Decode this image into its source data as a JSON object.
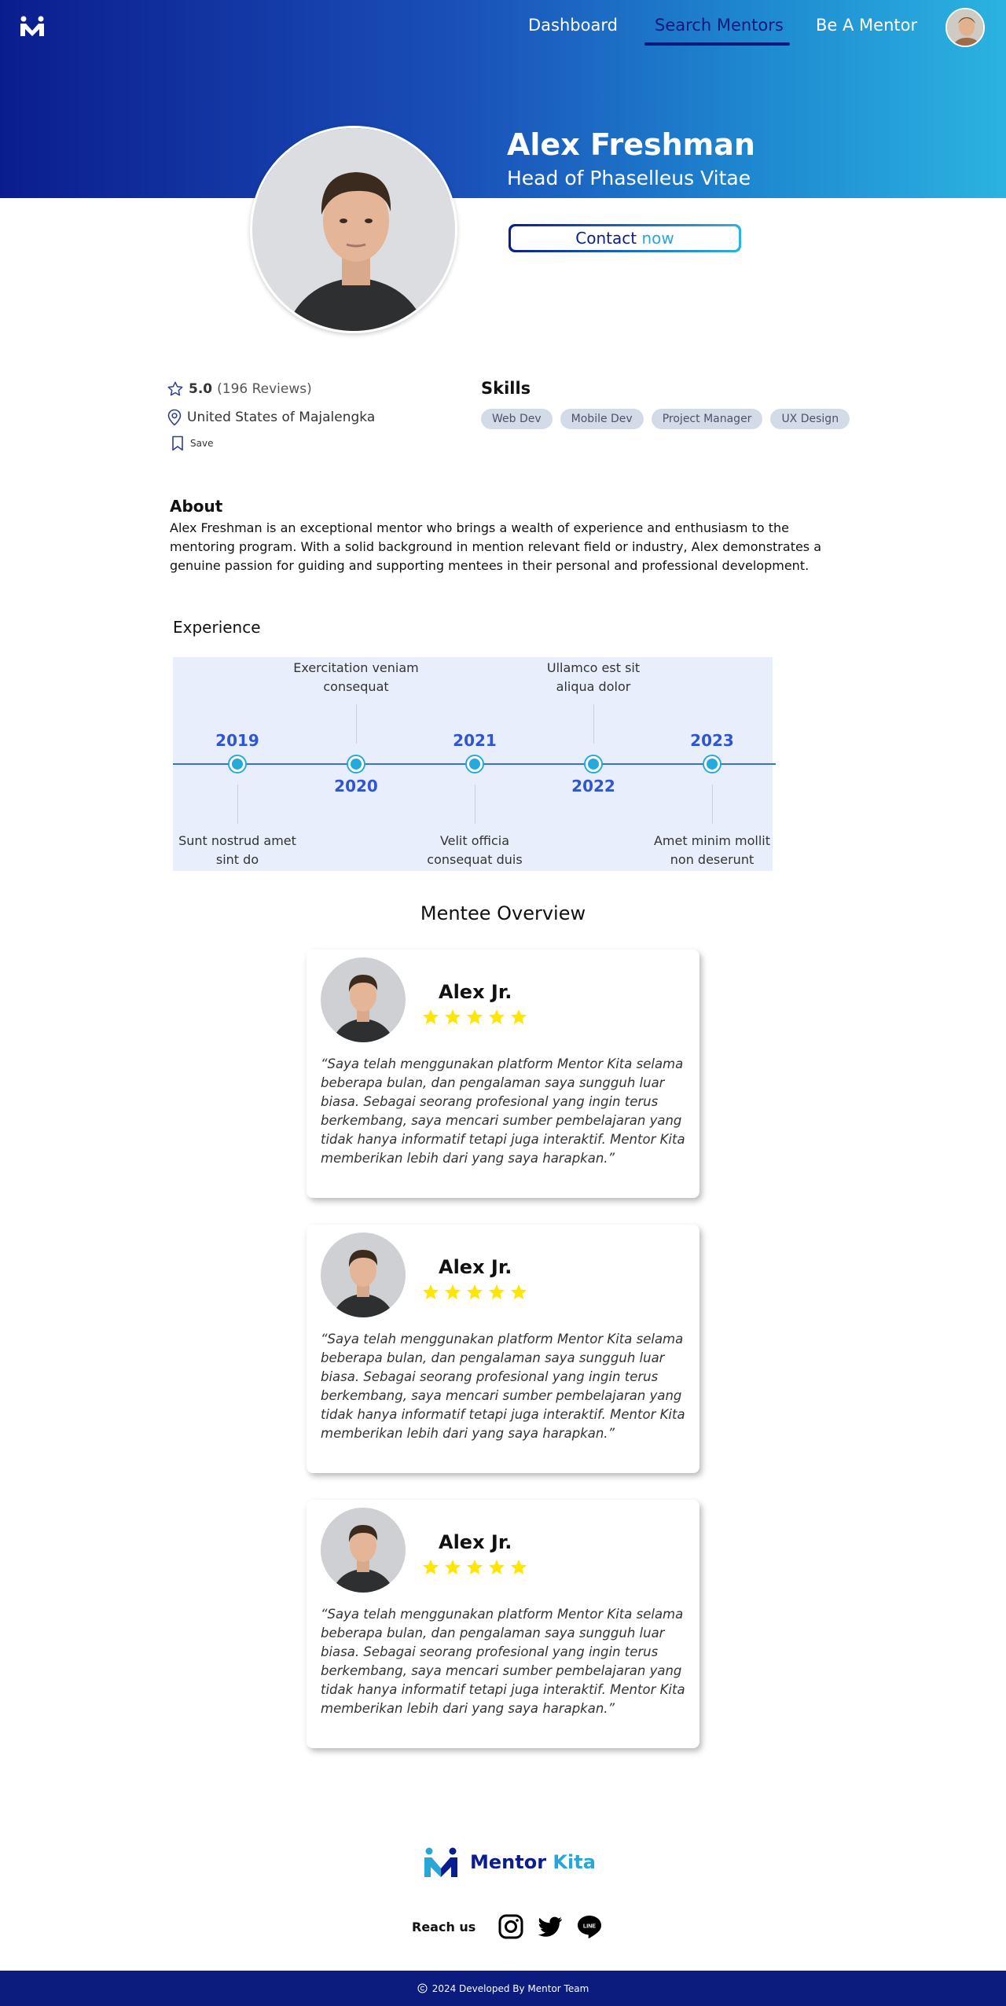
{
  "nav": {
    "items": [
      {
        "label": "Dashboard"
      },
      {
        "label": "Search Mentors"
      },
      {
        "label": "Be A Mentor"
      }
    ]
  },
  "profile": {
    "name": "Alex Freshman",
    "role": "Head of Phaselleus Vitae",
    "contact_label_a": "Contact",
    "contact_label_b": "now",
    "rating": "5.0",
    "reviews": "(196 Reviews)",
    "location": "United States of Majalengka",
    "save_label": "Save"
  },
  "skills": {
    "title": "Skills",
    "items": [
      "Web Dev",
      "Mobile Dev",
      "Project Manager",
      "UX Design"
    ]
  },
  "about": {
    "title": "About",
    "text": "Alex Freshman is an exceptional mentor who brings a wealth of experience  and enthusiasm to the mentoring program. With a solid background in mention relevant field or industry, Alex demonstrates a genuine  passion for guiding and supporting mentees in their personal and  professional development."
  },
  "experience": {
    "title": "Experience",
    "items": [
      {
        "year": "2019",
        "text": "Sunt nostrud amet sint do"
      },
      {
        "year": "2020",
        "text": "Exercitation veniam consequat"
      },
      {
        "year": "2021",
        "text": "Velit officia consequat duis"
      },
      {
        "year": "2022",
        "text": "Ullamco est sit aliqua dolor"
      },
      {
        "year": "2023",
        "text": "Amet minim mollit non deserunt"
      }
    ]
  },
  "overview": {
    "title": "Mentee Overview",
    "reviews": [
      {
        "name": "Alex Jr.",
        "stars": 5,
        "text": "“Saya telah menggunakan platform Mentor Kita selama beberapa bulan, dan  pengalaman saya sungguh luar biasa. Sebagai seorang profesional yang  ingin terus berkembang, saya mencari sumber pembelajaran yang tidak  hanya informatif tetapi juga interaktif. Mentor Kita memberikan lebih  dari yang saya harapkan.”"
      },
      {
        "name": "Alex Jr.",
        "stars": 5,
        "text": "“Saya telah menggunakan platform Mentor Kita selama beberapa bulan, dan  pengalaman saya sungguh luar biasa. Sebagai seorang profesional yang  ingin terus berkembang, saya mencari sumber pembelajaran yang tidak  hanya informatif tetapi juga interaktif. Mentor Kita memberikan lebih  dari yang saya harapkan.”"
      },
      {
        "name": "Alex Jr.",
        "stars": 5,
        "text": "“Saya telah menggunakan platform Mentor Kita selama beberapa bulan, dan  pengalaman saya sungguh luar biasa. Sebagai seorang profesional yang  ingin terus berkembang, saya mencari sumber pembelajaran yang tidak  hanya informatif tetapi juga interaktif. Mentor Kita memberikan lebih  dari yang saya harapkan.”"
      }
    ]
  },
  "footer": {
    "brand_a": "Mentor",
    "brand_b": "Kita",
    "reach_label": "Reach us",
    "socials": [
      "instagram-icon",
      "twitter-icon",
      "line-icon"
    ],
    "copyright": "2024 Developed By Mentor Team"
  },
  "colors": {
    "primary": "#0b1d8e",
    "accent": "#2aa5d8",
    "star": "#ffe600",
    "footer": "#0b1b7e"
  }
}
